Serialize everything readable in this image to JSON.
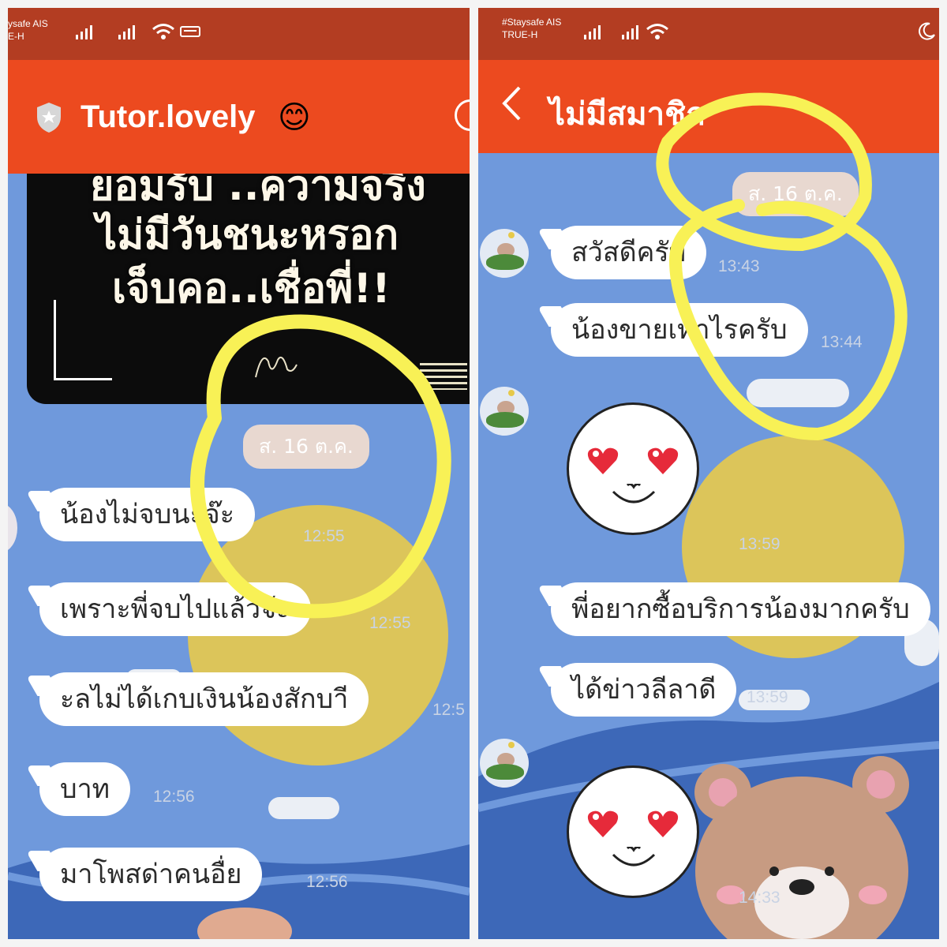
{
  "left": {
    "status": {
      "carrier_line1": "ysafe AIS",
      "carrier_line2": "E-H"
    },
    "header": {
      "title": "Tutor.lovely",
      "emoji": "😊"
    },
    "image_text": [
      "ยอมรับ ..ความจริง",
      "ไม่มีวันชนะหรอก",
      "เจ็บคอ..เชื่อพี่!!"
    ],
    "date_chip": "ส.  16  ต.ค.",
    "messages": [
      {
        "text": "น้องไม่จบนะจ๊ะ",
        "time": "12:55"
      },
      {
        "text": "เพราะพี่จบไปแล้วจ้ะ",
        "time": "12:55"
      },
      {
        "text": "ะลไม่ได้เกบเงินน้องสักบาี",
        "time": "12:5"
      },
      {
        "text": "บาท",
        "time": "12:56"
      },
      {
        "text": "มาโพสด่าคนอื่ย",
        "time": "12:56"
      }
    ]
  },
  "right": {
    "status": {
      "carrier_line1": "#Staysafe  AIS",
      "carrier_line2": "TRUE-H"
    },
    "header": {
      "title": "ไม่มีสมาชิก",
      "back": "<"
    },
    "date_chip": "ส.  16  ต.ค.",
    "messages": [
      {
        "text": "สวัสดีครับ",
        "time": "13:43"
      },
      {
        "text": "น้องขายเท่าไรครับ",
        "time": "13:44"
      },
      {
        "sticker": "heart-eyes-face-icon",
        "time": "13:59"
      },
      {
        "text": "พี่อยากซื้อบริการน้องมากครับ",
        "time": ""
      },
      {
        "text": "ได้ข่าวลีลาดี",
        "time": "13:59"
      },
      {
        "sticker": "heart-eyes-face-icon",
        "time": "14:33"
      }
    ]
  },
  "colors": {
    "status": "#b33d22",
    "header": "#ec4a1f",
    "chat_bg": "#6f99dc",
    "highlight": "#f8f156"
  }
}
